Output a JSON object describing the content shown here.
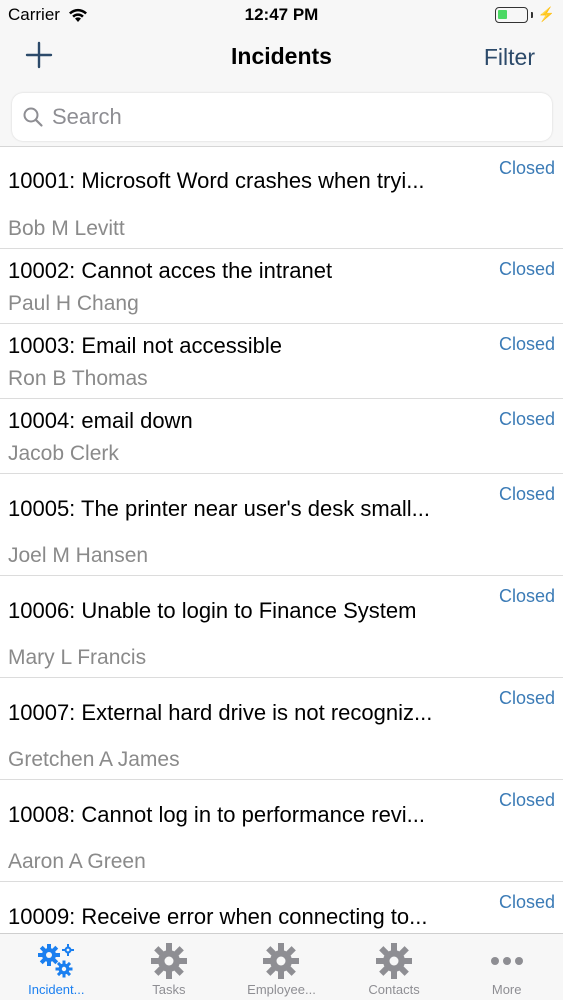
{
  "status_bar": {
    "carrier": "Carrier",
    "time": "12:47 PM",
    "wifi_icon": "wifi-icon",
    "battery_icon": "battery-icon",
    "charging_icon": "bolt-icon"
  },
  "nav": {
    "title": "Incidents",
    "add_icon": "plus-icon",
    "filter_label": "Filter"
  },
  "search": {
    "placeholder": "Search",
    "icon": "search-icon"
  },
  "incidents": [
    {
      "title": "10001: Microsoft Word crashes when tryi...",
      "person": "Bob M Levitt",
      "status": "Closed"
    },
    {
      "title": "10002: Cannot acces the intranet",
      "person": "Paul H Chang",
      "status": "Closed"
    },
    {
      "title": "10003: Email not accessible",
      "person": "Ron B Thomas",
      "status": "Closed"
    },
    {
      "title": "10004: email down",
      "person": "Jacob Clerk",
      "status": "Closed"
    },
    {
      "title": "10005: The printer near user's desk small...",
      "person": "Joel M Hansen",
      "status": "Closed"
    },
    {
      "title": "10006: Unable to login to Finance System",
      "person": "Mary L Francis",
      "status": "Closed"
    },
    {
      "title": "10007: External hard drive is not recogniz...",
      "person": "Gretchen A James",
      "status": "Closed"
    },
    {
      "title": "10008: Cannot log in to performance revi...",
      "person": "Aaron A Green",
      "status": "Closed"
    },
    {
      "title": "10009: Receive error when connecting to...",
      "person": "",
      "status": "Closed"
    }
  ],
  "tabs": [
    {
      "label": "Incident...",
      "icon": "gears-icon",
      "active": true
    },
    {
      "label": "Tasks",
      "icon": "gear-icon",
      "active": false
    },
    {
      "label": "Employee...",
      "icon": "gear-icon",
      "active": false
    },
    {
      "label": "Contacts",
      "icon": "gear-icon",
      "active": false
    },
    {
      "label": "More",
      "icon": "more-icon",
      "active": false
    }
  ],
  "colors": {
    "accent": "#1a7ff0",
    "status_text": "#3b7bb6",
    "nav_button": "#2c4a6a",
    "inactive_tab": "#8e8e93"
  }
}
